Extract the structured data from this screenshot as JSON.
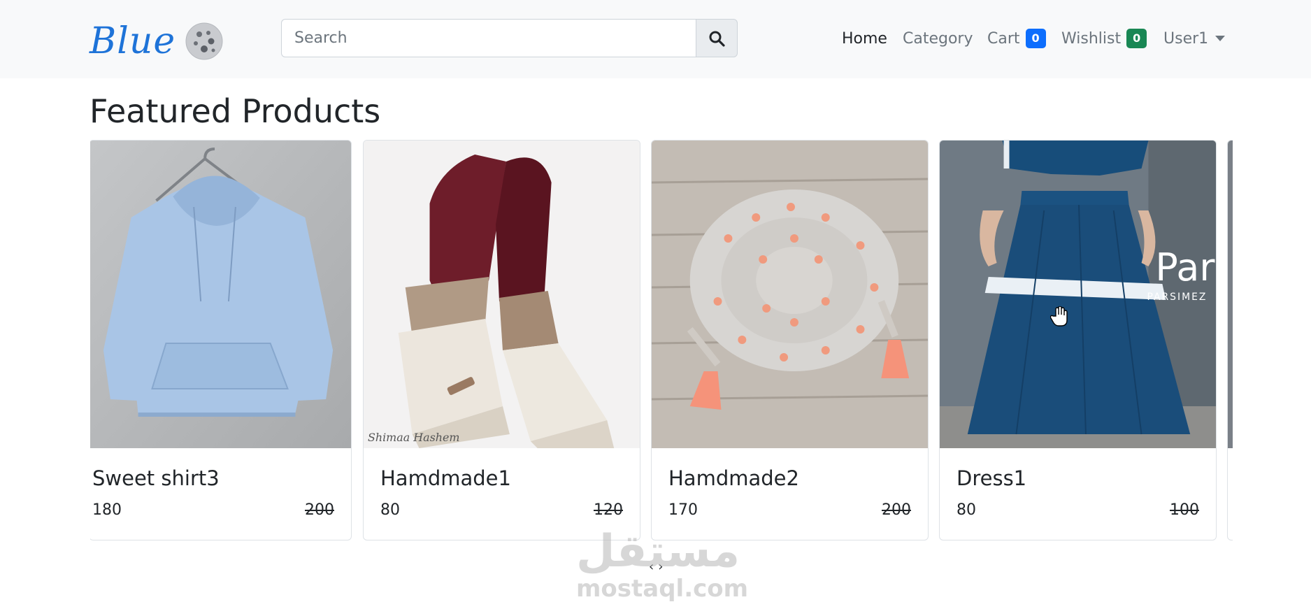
{
  "brand": {
    "name": "Blue",
    "logo_icon": "moon-icon"
  },
  "search": {
    "placeholder": "Search",
    "button_icon": "search-icon"
  },
  "nav": {
    "home": "Home",
    "category": "Category",
    "cart": {
      "label": "Cart",
      "count": "0"
    },
    "wishlist": {
      "label": "Wishlist",
      "count": "0"
    },
    "user": {
      "label": "User1",
      "icon": "chevron-down-icon"
    }
  },
  "page": {
    "title": "Featured Products"
  },
  "products": [
    {
      "name": "Sweet shirt3",
      "price": "180",
      "old_price": "200"
    },
    {
      "name": "Hamdmade1",
      "price": "80",
      "old_price": "120"
    },
    {
      "name": "Hamdmade2",
      "price": "170",
      "old_price": "200"
    },
    {
      "name": "Dress1",
      "price": "80",
      "old_price": "100"
    }
  ],
  "image_text": {
    "scarf_credit": "Shimaa Hashem",
    "dress_watermark": "Pars",
    "dress_watermark_sub": "PARSIMEZ"
  },
  "carousel": {
    "prev": "‹",
    "next": "›"
  },
  "watermark": {
    "arabic": "مستقل",
    "latin": "mostaql.com"
  },
  "colors": {
    "brand": "#1e73d8",
    "navbar_bg": "#f8f9fa",
    "cart_badge": "#0d6efd",
    "wishlist_badge": "#198754"
  }
}
